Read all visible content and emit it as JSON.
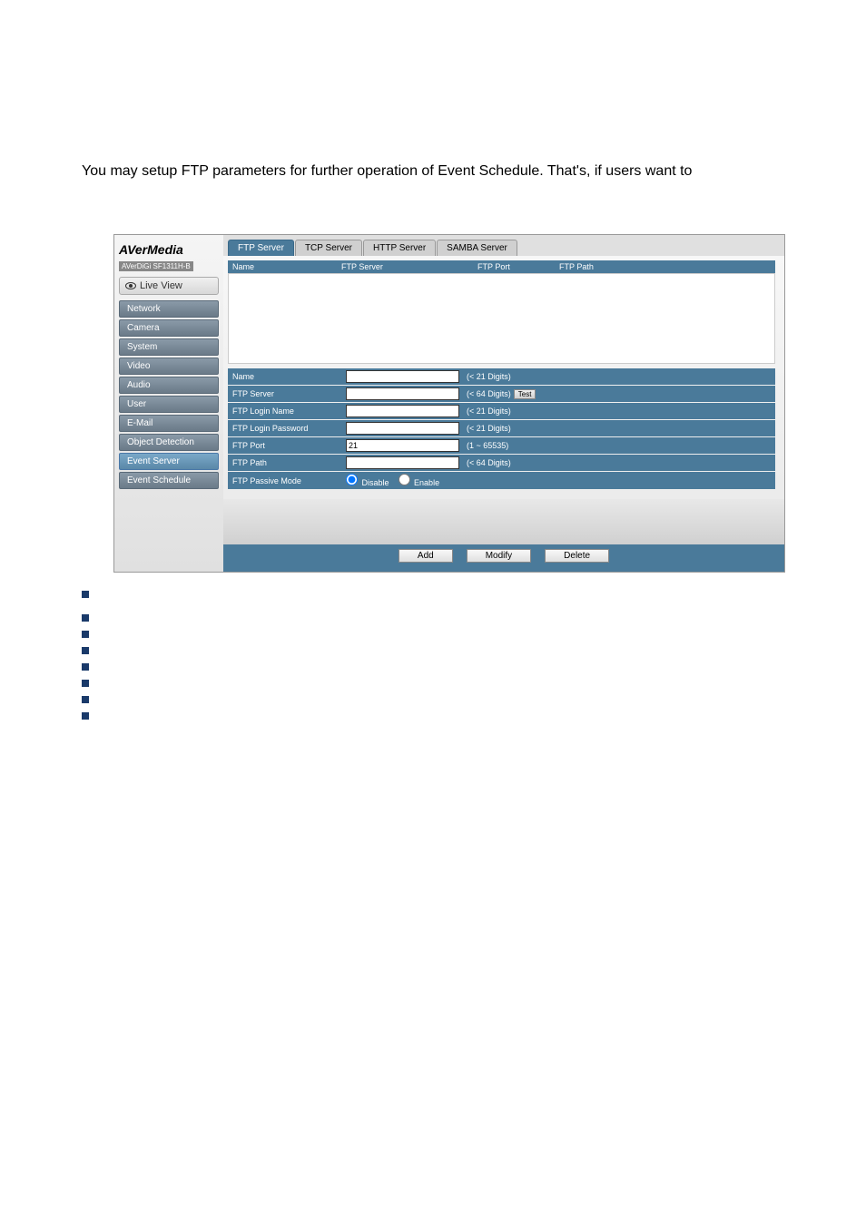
{
  "intro": "You may setup FTP parameters for further operation of Event Schedule. That's, if users want to",
  "logo": {
    "brand": "AVerMedia",
    "model": "AVerDiGi SF1311H-B"
  },
  "live_view": "Live View",
  "nav": {
    "items": [
      "Network",
      "Camera",
      "System",
      "Video",
      "Audio",
      "User",
      "E-Mail",
      "Object Detection",
      "Event Server",
      "Event Schedule"
    ],
    "active_index": 8
  },
  "tabs": {
    "items": [
      "FTP Server",
      "TCP Server",
      "HTTP Server",
      "SAMBA Server"
    ],
    "active_index": 0
  },
  "list": {
    "headers": [
      "Name",
      "FTP Server",
      "FTP Port",
      "FTP Path"
    ]
  },
  "form": {
    "name": {
      "label": "Name",
      "value": "",
      "hint": "(< 21 Digits)"
    },
    "server": {
      "label": "FTP Server",
      "value": "",
      "hint": "(< 64 Digits)",
      "test": "Test"
    },
    "login": {
      "label": "FTP Login Name",
      "value": "",
      "hint": "(< 21 Digits)"
    },
    "password": {
      "label": "FTP Login Password",
      "value": "",
      "hint": "(< 21 Digits)"
    },
    "port": {
      "label": "FTP Port",
      "value": "21",
      "hint": "(1 ~ 65535)"
    },
    "path": {
      "label": "FTP Path",
      "value": "",
      "hint": "(< 64 Digits)"
    },
    "passive": {
      "label": "FTP Passive Mode",
      "disable": "Disable",
      "enable": "Enable",
      "selected": "disable"
    }
  },
  "buttons": {
    "add": "Add",
    "modify": "Modify",
    "delete": "Delete"
  }
}
